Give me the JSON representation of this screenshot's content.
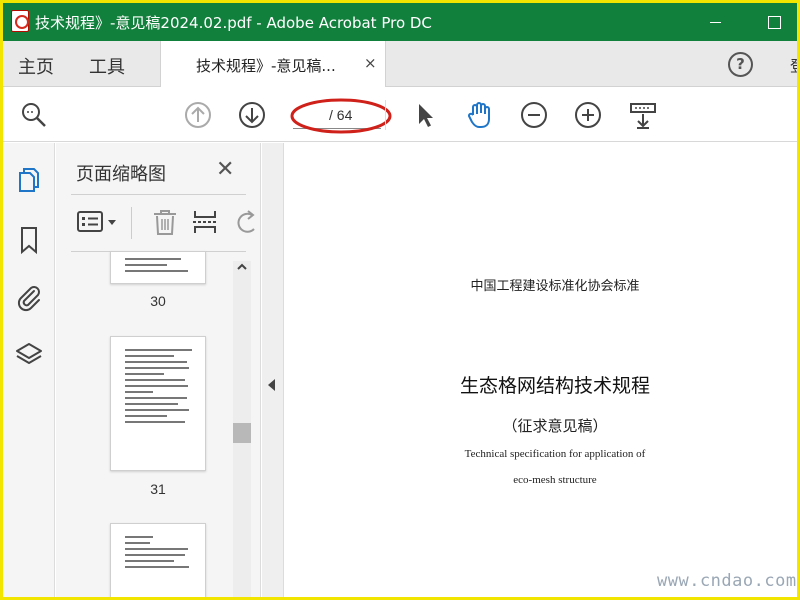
{
  "window": {
    "title": "技术规程》-意见稿2024.02.pdf - Adobe Acrobat Pro DC"
  },
  "tabs": {
    "home": "主页",
    "tools": "工具",
    "document": "技术规程》-意见稿...",
    "close_symbol": "×",
    "help_symbol": "?",
    "signin": "登"
  },
  "toolbar": {
    "icons": [
      "search-icon",
      "page-up-icon",
      "page-down-icon",
      "select-cursor-icon",
      "hand-tool-icon",
      "zoom-out-icon",
      "zoom-in-icon",
      "scroll-mode-icon"
    ],
    "current_page": "",
    "page_total": "/ 64",
    "highlight_color": "#d0201a",
    "hand_color": "#1f76c8"
  },
  "sidebar": {
    "icons": [
      "page-thumbnails-icon",
      "bookmark-icon",
      "attachment-icon",
      "layers-icon"
    ],
    "accent_color": "#1f76c8"
  },
  "thumbnails_panel": {
    "title": "页面缩略图",
    "close_symbol": "✕",
    "tools": [
      "thumbnail-options-icon",
      "delete-icon",
      "insert-page-icon",
      "rotate-icon"
    ],
    "pages": [
      "30",
      "31",
      ""
    ]
  },
  "document": {
    "org_line": "中国工程建设标准化协会标准",
    "title": "生态格网结构技术规程",
    "subtitle": "（征求意见稿）",
    "english_line1": "Technical specification for application of",
    "english_line2": "eco-mesh structure"
  },
  "watermark": "www.cndao.com",
  "colors": {
    "titlebar": "#12803d",
    "border": "#f2e600"
  }
}
